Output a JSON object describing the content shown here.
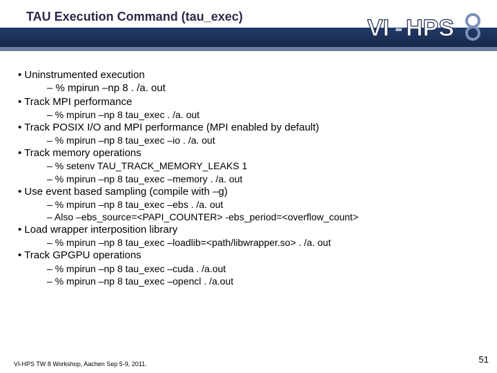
{
  "title": "TAU Execution Command (tau_exec)",
  "logo_text": "VI-HPS",
  "bullets": [
    {
      "level": 1,
      "text": "Uninstrumented execution"
    },
    {
      "level": 2,
      "size": "n",
      "text": "% mpirun –np 8 . /a. out"
    },
    {
      "level": 1,
      "text": "Track MPI performance"
    },
    {
      "level": 2,
      "size": "s",
      "text": "% mpirun –np 8  tau_exec . /a. out"
    },
    {
      "level": 1,
      "text": "Track POSIX I/O and MPI performance (MPI enabled by default)"
    },
    {
      "level": 2,
      "size": "s",
      "text": "% mpirun –np 8 tau_exec –io . /a. out"
    },
    {
      "level": 1,
      "text": "Track memory operations"
    },
    {
      "level": 2,
      "size": "s",
      "text": "% setenv TAU_TRACK_MEMORY_LEAKS   1"
    },
    {
      "level": 2,
      "size": "s",
      "text": "% mpirun –np 8 tau_exec –memory . /a. out"
    },
    {
      "level": 1,
      "text": "Use event based sampling (compile with –g)"
    },
    {
      "level": 2,
      "size": "s",
      "text": "% mpirun –np 8 tau_exec –ebs . /a. out"
    },
    {
      "level": 2,
      "size": "s",
      "text": "Also –ebs_source=<PAPI_COUNTER> -ebs_period=<overflow_count>"
    },
    {
      "level": 1,
      "text": "Load wrapper interposition library"
    },
    {
      "level": 2,
      "size": "s",
      "text": "% mpirun –np 8 tau_exec –loadlib=<path/libwrapper.so> . /a. out"
    },
    {
      "level": 1,
      "text": "Track GPGPU operations"
    },
    {
      "level": 2,
      "size": "s",
      "text": "% mpirun –np 8 tau_exec –cuda . /a.out"
    },
    {
      "level": 2,
      "size": "s",
      "text": "% mpirun –np 8 tau_exec –opencl . /a.out"
    }
  ],
  "footer": "VI-HPS TW 8 Workshop, Aachen Sep 5-9, 2011.",
  "page_number": "51"
}
